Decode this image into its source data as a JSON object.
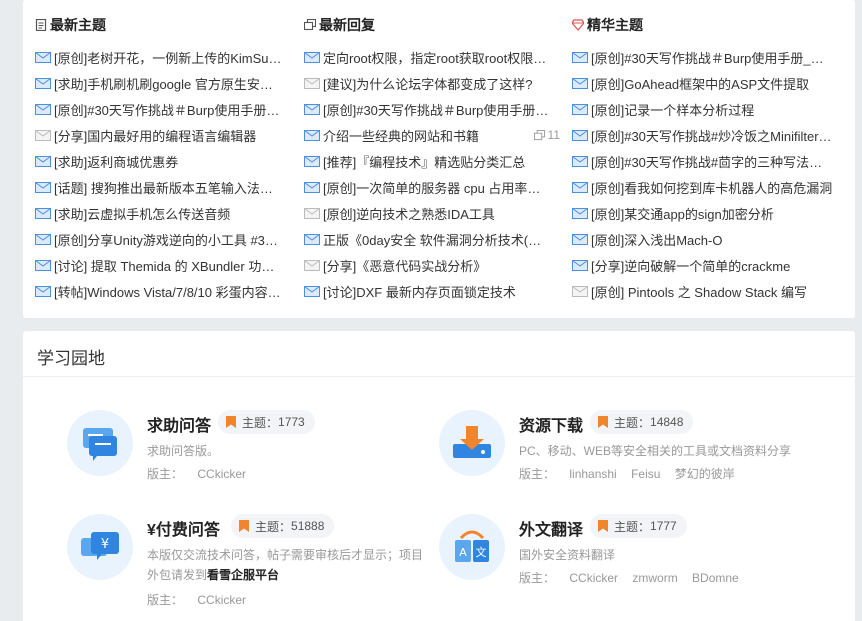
{
  "columns": [
    {
      "title": "最新主题",
      "icon": "document-icon",
      "items": [
        {
          "text": "[原创]老树开花，一例新上传的KimSu…",
          "read": false
        },
        {
          "text": "[求助]手机刷机刷google 官方原生安…",
          "read": false
        },
        {
          "text": "[原创]#30天写作挑战＃Burp使用手册…",
          "read": false
        },
        {
          "text": "[分享]国内最好用的编程语言编辑器",
          "read": true
        },
        {
          "text": "[求助]返利商城优惠券",
          "read": false
        },
        {
          "text": "[话题] 搜狗推出最新版本五笔输入法…",
          "read": false
        },
        {
          "text": "[求助]云虚拟手机怎么传送音频",
          "read": false
        },
        {
          "text": "[原创]分享Unity游戏逆向的小工具 #3…",
          "read": false
        },
        {
          "text": "[讨论] 提取 Themida 的 XBundler 功…",
          "read": false
        },
        {
          "text": "[转帖]Windows Vista/7/8/10 彩蛋内容…",
          "read": false
        }
      ]
    },
    {
      "title": "最新回复",
      "icon": "reply-icon",
      "items": [
        {
          "text": "定向root权限，指定root获取root权限…",
          "read": false
        },
        {
          "text": "[建议]为什么论坛字体都变成了这样?",
          "read": true
        },
        {
          "text": "[原创]#30天写作挑战＃Burp使用手册…",
          "read": false
        },
        {
          "text": "介绍一些经典的网站和书籍",
          "read": false,
          "replies": "11"
        },
        {
          "text": "[推荐]『编程技术』精选贴分类汇总",
          "read": false
        },
        {
          "text": "[原创]一次简单的服务器 cpu 占用率…",
          "read": false
        },
        {
          "text": "[原创]逆向技术之熟悉IDA工具",
          "read": true
        },
        {
          "text": "正版《0day安全 软件漏洞分析技术(…",
          "read": false
        },
        {
          "text": "[分享]《恶意代码实战分析》",
          "read": true
        },
        {
          "text": "[讨论]DXF 最新内存页面锁定技术",
          "read": false
        }
      ]
    },
    {
      "title": "精华主题",
      "icon": "diamond-icon",
      "items": [
        {
          "text": "[原创]#30天写作挑战＃Burp使用手册_…",
          "read": false
        },
        {
          "text": "[原创]GoAhead框架中的ASP文件提取",
          "read": false
        },
        {
          "text": "[原创]记录一个样本分析过程",
          "read": false
        },
        {
          "text": "[原创]#30天写作挑战#炒冷饭之Minifilter…",
          "read": false
        },
        {
          "text": "[原创]#30天写作挑战#茴字的三种写法…",
          "read": false
        },
        {
          "text": "[原创]看我如何挖到库卡机器人的高危漏洞",
          "read": false
        },
        {
          "text": "[原创]某交通app的sign加密分析",
          "read": false
        },
        {
          "text": "[原创]深入浅出Mach-O",
          "read": false
        },
        {
          "text": "[分享]逆向破解一个简单的crackme",
          "read": false
        },
        {
          "text": "[原创] Pintools 之 Shadow Stack 编写",
          "read": true
        }
      ]
    }
  ],
  "garden": {
    "title": "学习园地",
    "topic_label": "主题：",
    "mod_label": "版主：",
    "forums": [
      {
        "name": "求助问答",
        "icon": "chat-bubble-icon",
        "topics": "1773",
        "desc": "求助问答版。",
        "desc2": "",
        "desc2_bold": "",
        "mods": [
          "CCkicker"
        ]
      },
      {
        "name": "资源下载",
        "icon": "download-icon",
        "topics": "14848",
        "desc": "PC、移动、WEB等安全相关的工具或文档资料分享",
        "desc2": "",
        "desc2_bold": "",
        "mods": [
          "linhanshi",
          "Feisu",
          "梦幻的彼岸"
        ]
      },
      {
        "name": "¥付费问答",
        "icon": "yen-chat-icon",
        "topics": "51888",
        "desc": "本版仅交流技术问答，帖子需要审核后才显示；项目",
        "desc2": "外包请发到",
        "desc2_bold": "看雪企服平台",
        "mods": [
          "CCkicker"
        ]
      },
      {
        "name": "外文翻译",
        "icon": "translate-icon",
        "topics": "1777",
        "desc": "国外安全资料翻译",
        "desc2": "",
        "desc2_bold": "",
        "mods": [
          "CCkicker",
          "zmworm",
          "BDomne"
        ]
      }
    ]
  },
  "colors": {
    "accent_blue": "#3a8ee6",
    "mail_blue": "#4a90e2",
    "mail_read": "#bbbbbb",
    "badge_orange": "#f0852d",
    "diamond_red": "#e05050"
  }
}
